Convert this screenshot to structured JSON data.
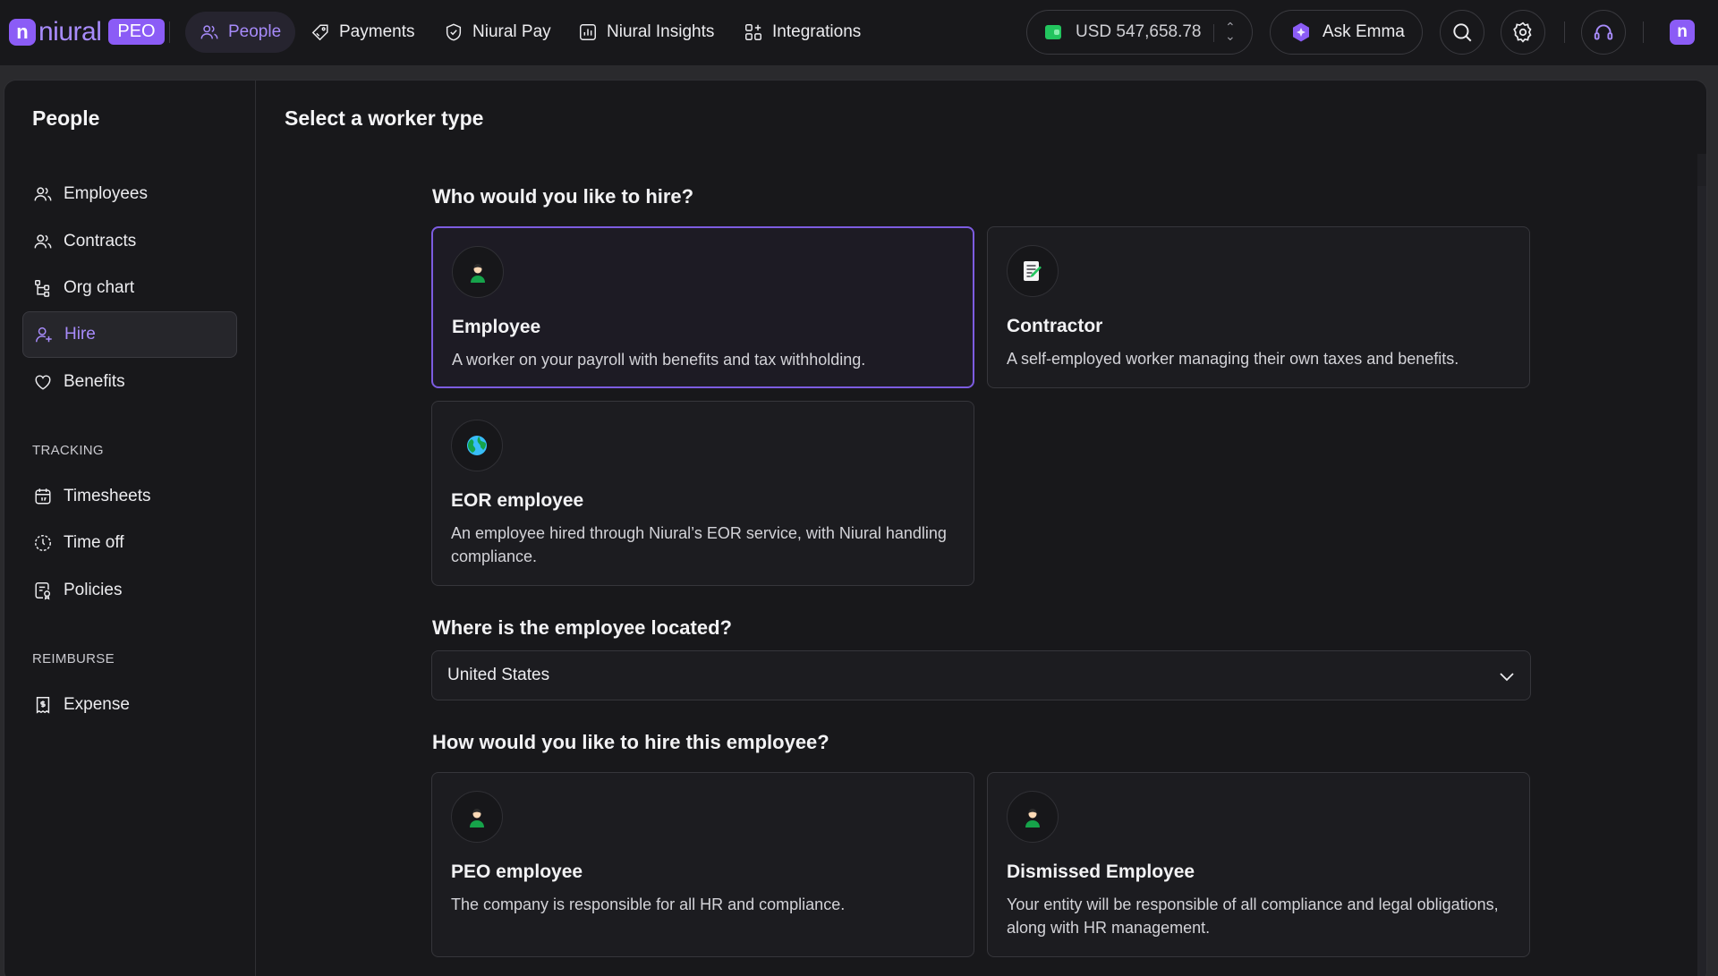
{
  "brand": {
    "logo_text": "niural",
    "badge": "PEO"
  },
  "nav": [
    {
      "label": "People",
      "icon": "users-icon",
      "active": true
    },
    {
      "label": "Payments",
      "icon": "tag-icon"
    },
    {
      "label": "Niural Pay",
      "icon": "shield-check-icon"
    },
    {
      "label": "Niural Insights",
      "icon": "chart-icon"
    },
    {
      "label": "Integrations",
      "icon": "grid-plus-icon"
    }
  ],
  "balance": {
    "text": "USD 547,658.78"
  },
  "assistant": {
    "label": "Ask Emma"
  },
  "sidebar": {
    "title": "People",
    "items": [
      {
        "label": "Employees",
        "icon": "users-icon"
      },
      {
        "label": "Contracts",
        "icon": "users-icon"
      },
      {
        "label": "Org chart",
        "icon": "org-chart-icon"
      },
      {
        "label": "Hire",
        "icon": "user-plus-icon",
        "active": true
      },
      {
        "label": "Benefits",
        "icon": "heart-icon"
      }
    ],
    "tracking_header": "TRACKING",
    "tracking_items": [
      {
        "label": "Timesheets",
        "icon": "calendar-icon"
      },
      {
        "label": "Time off",
        "icon": "clock-icon"
      },
      {
        "label": "Policies",
        "icon": "policy-icon"
      }
    ],
    "reimburse_header": "REIMBURSE",
    "reimburse_items": [
      {
        "label": "Expense",
        "icon": "receipt-icon"
      }
    ]
  },
  "main": {
    "title": "Select a worker type",
    "q_hire": "Who would you like to hire?",
    "worker_types": [
      {
        "title": "Employee",
        "desc": "A worker on your payroll with benefits and tax withholding.",
        "icon": "person-icon",
        "selected": true
      },
      {
        "title": "Contractor",
        "desc": "A self-employed worker managing their own taxes and benefits.",
        "icon": "document-edit-icon"
      },
      {
        "title": "EOR employee",
        "desc": "An employee hired through Niural’s EOR service, with Niural handling compliance.",
        "icon": "globe-icon"
      }
    ],
    "q_location": "Where is the employee located?",
    "location_value": "United States",
    "q_method": "How would you like to hire this employee?",
    "hire_methods": [
      {
        "title": "PEO employee",
        "desc": "The company is responsible for all HR and compliance.",
        "icon": "person-icon"
      },
      {
        "title": "Dismissed Employee",
        "desc": "Your entity will be responsible of all compliance and legal obligations, along with HR management.",
        "icon": "person-icon"
      }
    ]
  },
  "colors": {
    "accent": "#8b5cf6",
    "accent_text": "#a78bfa",
    "background": "#18181b",
    "green": "#22c55e"
  }
}
